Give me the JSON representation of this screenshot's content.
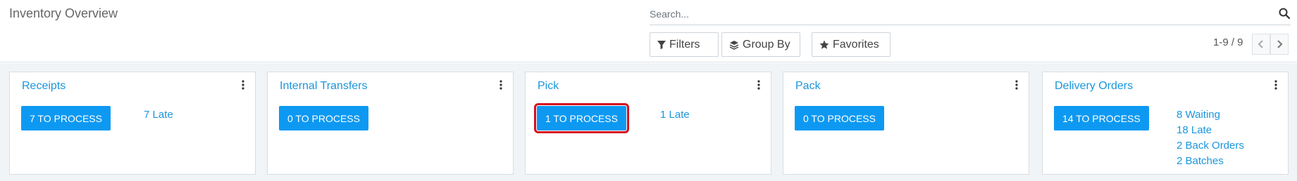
{
  "header": {
    "title": "Inventory Overview"
  },
  "search": {
    "placeholder": "Search..."
  },
  "toolbar": {
    "filters_label": "Filters",
    "group_by_label": "Group By",
    "favorites_label": "Favorites"
  },
  "pager": {
    "value": "1-9 / 9"
  },
  "cards": [
    {
      "title": "Receipts",
      "process_label": "7 TO PROCESS",
      "stats": [
        "7 Late"
      ]
    },
    {
      "title": "Internal Transfers",
      "process_label": "0 TO PROCESS",
      "stats": []
    },
    {
      "title": "Pick",
      "process_label": "1 TO PROCESS",
      "stats": [
        "1 Late"
      ]
    },
    {
      "title": "Pack",
      "process_label": "0 TO PROCESS",
      "stats": []
    },
    {
      "title": "Delivery Orders",
      "process_label": "14 TO PROCESS",
      "stats": [
        "8 Waiting",
        "18 Late",
        "2 Back Orders",
        "2 Batches"
      ]
    }
  ],
  "colors": {
    "accent": "#0d99f2",
    "link": "#1a96dc",
    "highlight": "#d80f1e",
    "background": "#f0f4f7"
  },
  "icons": {
    "search": "search-icon",
    "filter": "filter-icon",
    "group_by": "layers-icon",
    "favorites": "star-icon",
    "pager_previous": "chevron-left-icon",
    "pager_next": "chevron-right-icon",
    "card_menu": "kebab-menu-icon"
  }
}
